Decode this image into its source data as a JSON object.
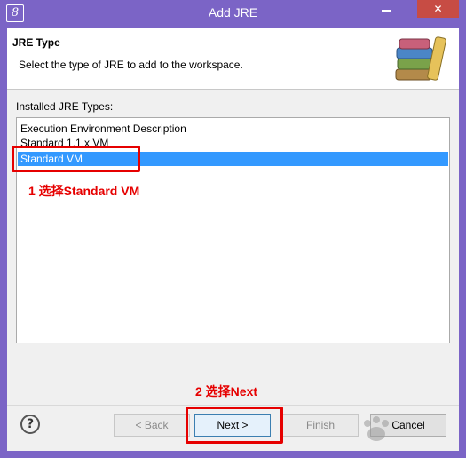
{
  "window": {
    "title": "Add JRE",
    "close_glyph": "✕"
  },
  "banner": {
    "title": "JRE Type",
    "description": "Select the type of JRE to add to the workspace.",
    "icon": "books-library-icon"
  },
  "list": {
    "label": "Installed JRE Types:",
    "items": [
      {
        "label": "Execution Environment Description",
        "selected": false
      },
      {
        "label": "Standard 1.1.x VM",
        "selected": false
      },
      {
        "label": "Standard VM",
        "selected": true
      }
    ]
  },
  "annotations": {
    "step1": "1 选择Standard VM",
    "step2": "2 选择Next"
  },
  "buttons": {
    "back": "< Back",
    "next": "Next >",
    "finish": "Finish",
    "cancel": "Cancel",
    "help": "?"
  },
  "colors": {
    "frame": "#7b64c6",
    "selection": "#3399ff",
    "annotation": "#e60000"
  }
}
